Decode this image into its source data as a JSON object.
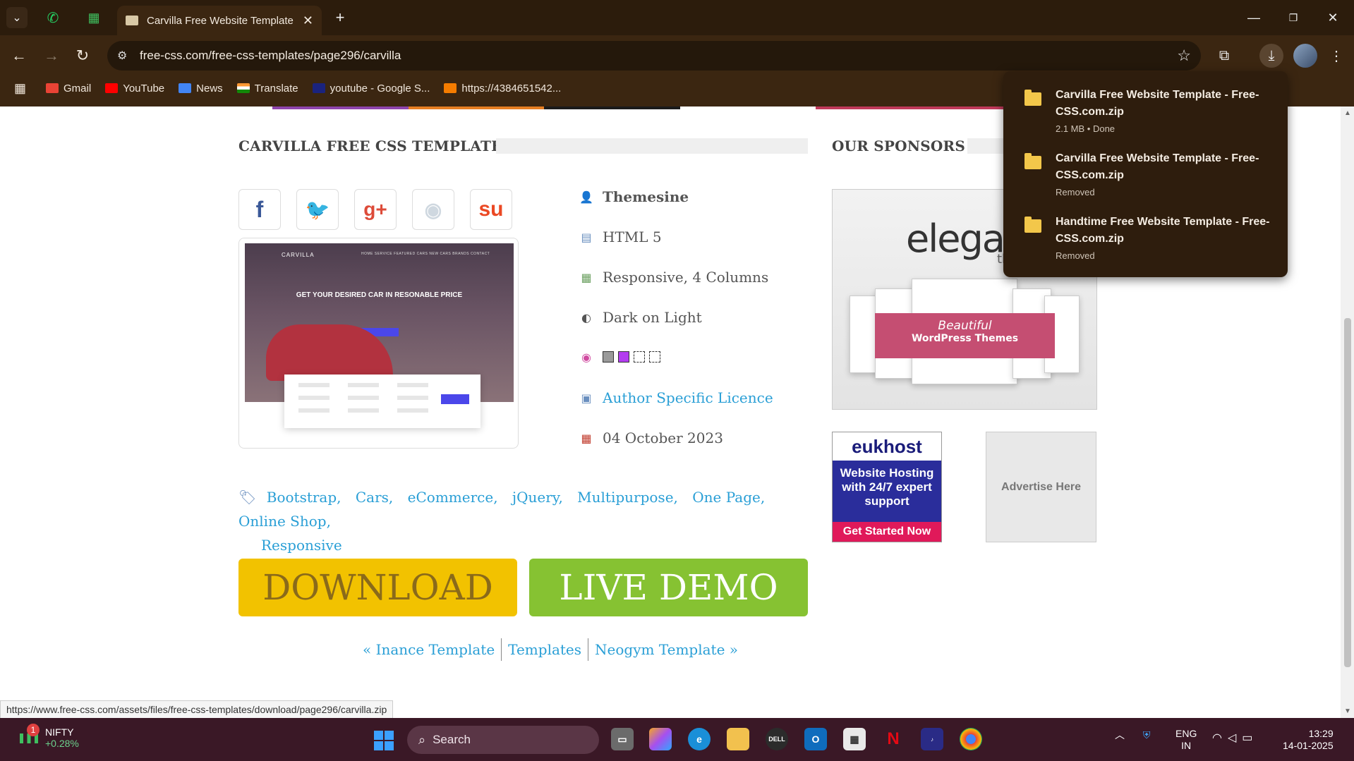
{
  "browser": {
    "tab_title": "Carvilla Free Website Template |",
    "url": "free-css.com/free-css-templates/page296/carvilla",
    "bookmarks": [
      {
        "label": "Gmail",
        "color": "#ea4335"
      },
      {
        "label": "YouTube",
        "color": "#ff0000"
      },
      {
        "label": "News",
        "color": "#4285f4"
      },
      {
        "label": "Translate",
        "color": "#ff9933"
      },
      {
        "label": "youtube - Google S...",
        "color": "#1a237e"
      },
      {
        "label": "https://4384651542...",
        "color": "#f57c00"
      }
    ],
    "status_url": "https://www.free-css.com/assets/files/free-css-templates/download/page296/carvilla.zip"
  },
  "downloads": {
    "items": [
      {
        "name": "Carvilla Free Website Template - Free-CSS.com.zip",
        "status": "2.1 MB • Done"
      },
      {
        "name": "Carvilla Free Website Template - Free-CSS.com.zip",
        "status": "Removed"
      },
      {
        "name": "Handtime Free Website Template - Free-CSS.com.zip",
        "status": "Removed"
      }
    ]
  },
  "page": {
    "section_title": "CARVILLA FREE CSS TEMPLATE",
    "sponsors_title": "OUR SPONSORS",
    "share_icons": [
      "facebook-icon",
      "twitter-icon",
      "google-plus-icon",
      "reddit-icon",
      "stumbleupon-icon"
    ],
    "preview": {
      "brand": "CARVILLA",
      "nav": "HOME   SERVICE   FEATURED CARS   NEW CARS   BRANDS   CONTACT",
      "headline": "GET YOUR DESIRED CAR IN RESONABLE PRICE"
    },
    "meta": {
      "author": "Themesine",
      "html": "HTML 5",
      "layout": "Responsive, 4 Columns",
      "scheme": "Dark on Light",
      "colors": [
        "#9a9a9a",
        "#b33cf0",
        "#ffffff",
        "#ffffff"
      ],
      "licence": "Author Specific Licence",
      "date": "04 October 2023"
    },
    "tags": [
      "Bootstrap,",
      "Cars,",
      "eCommerce,",
      "jQuery,",
      "Multipurpose,",
      "One Page,",
      "Online Shop,",
      "Responsive"
    ],
    "download_label": "DOWNLOAD",
    "demo_label": "LIVE DEMO",
    "pager": {
      "prev": "« Inance Template",
      "center": "Templates",
      "next": "Neogym Template »"
    },
    "ads": {
      "elegant_word": "elegan",
      "elegant_sub": "them",
      "elegant_banner_1": "Beautiful",
      "elegant_banner_2": "WordPress Themes",
      "eukhost_logo": "eukhost",
      "eukhost_line": "Website Hosting with 24/7 expert support",
      "eukhost_cta": "Get Started Now",
      "advertise": "Advertise Here"
    }
  },
  "taskbar": {
    "ticker_badge": "1",
    "ticker_label": "NIFTY",
    "ticker_change": "+0.28%",
    "search_label": "Search",
    "lang_1": "ENG",
    "lang_2": "IN",
    "time": "13:29",
    "date": "14-01-2025"
  }
}
